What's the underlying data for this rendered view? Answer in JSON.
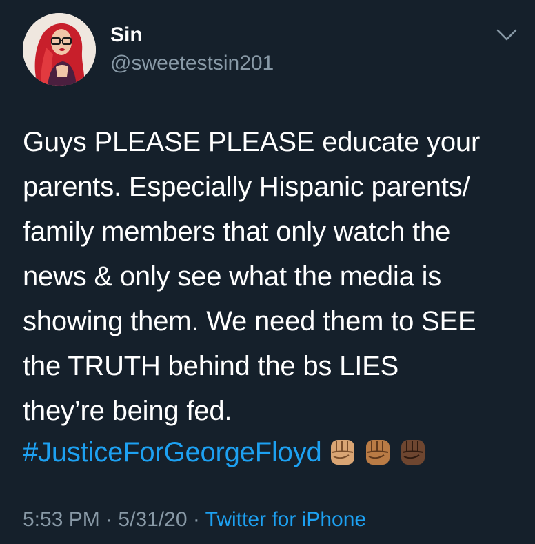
{
  "tweet": {
    "author": {
      "display_name": "Sin",
      "handle": "@sweetestsin201",
      "avatar_icon": "profile-photo"
    },
    "body": "Guys PLEASE PLEASE educate your\nparents. Especially Hispanic parents/\nfamily members that only watch the\nnews & only see what the media is\nshowing them. We need them to SEE\nthe TRUTH behind the bs LIES\nthey’re being fed.",
    "hashtag": "#JusticeForGeorgeFloyd",
    "emojis": [
      {
        "name": "raised-fist-medium-light",
        "skin": "#d9a574"
      },
      {
        "name": "raised-fist-medium",
        "skin": "#b97b45"
      },
      {
        "name": "raised-fist-dark",
        "skin": "#6e4630"
      }
    ],
    "meta": {
      "time": "5:53 PM",
      "separator": "·",
      "date": "5/31/20",
      "source": "Twitter for iPhone"
    },
    "menu_icon": "chevron-down-icon"
  },
  "colors": {
    "background": "#15202b",
    "text": "#ffffff",
    "secondary_text": "#8899a6",
    "link": "#1da1f2"
  }
}
